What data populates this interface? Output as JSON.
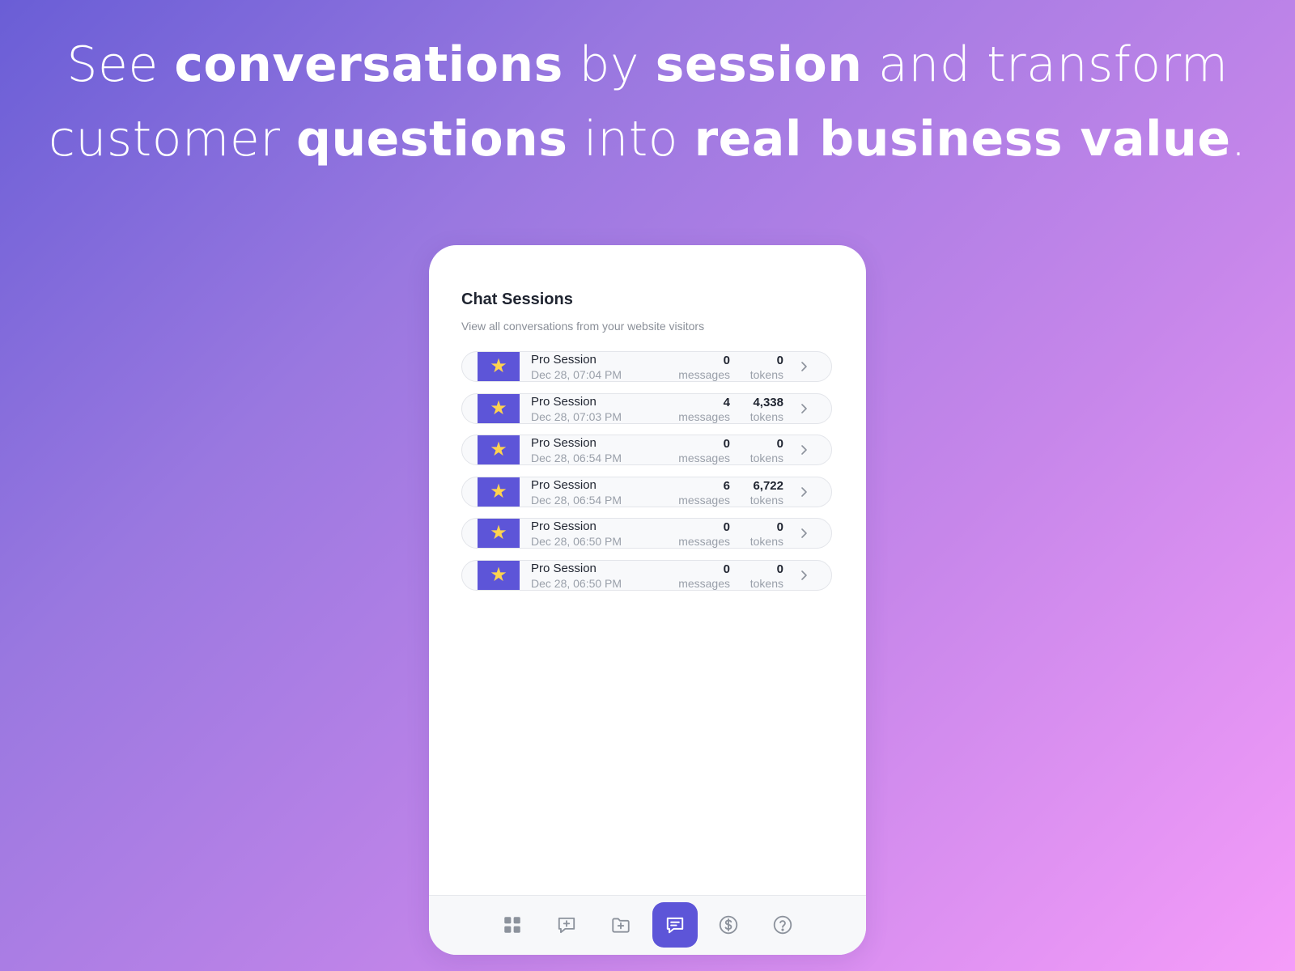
{
  "headline": {
    "line1": {
      "t1": "See ",
      "b1": "conversations",
      "t2": " by ",
      "b2": "session",
      "t3": " and transform"
    },
    "line2": {
      "t1": "customer ",
      "b1": "questions",
      "t2": " into ",
      "b2": "real business value",
      "t3": "."
    }
  },
  "card": {
    "title": "Chat Sessions",
    "subtitle": "View all conversations from your website visitors"
  },
  "sessions": [
    {
      "name": "Pro Session",
      "date": "Dec 28, 07:04 PM",
      "messages": "0",
      "messages_label": "messages",
      "tokens": "0",
      "tokens_label": "tokens",
      "badge_icon": "star-icon"
    },
    {
      "name": "Pro Session",
      "date": "Dec 28, 07:03 PM",
      "messages": "4",
      "messages_label": "messages",
      "tokens": "4,338",
      "tokens_label": "tokens",
      "badge_icon": "star-icon"
    },
    {
      "name": "Pro Session",
      "date": "Dec 28, 06:54 PM",
      "messages": "0",
      "messages_label": "messages",
      "tokens": "0",
      "tokens_label": "tokens",
      "badge_icon": "star-icon"
    },
    {
      "name": "Pro Session",
      "date": "Dec 28, 06:54 PM",
      "messages": "6",
      "messages_label": "messages",
      "tokens": "6,722",
      "tokens_label": "tokens",
      "badge_icon": "star-icon"
    },
    {
      "name": "Pro Session",
      "date": "Dec 28, 06:50 PM",
      "messages": "0",
      "messages_label": "messages",
      "tokens": "0",
      "tokens_label": "tokens",
      "badge_icon": "star-icon"
    },
    {
      "name": "Pro Session",
      "date": "Dec 28, 06:50 PM",
      "messages": "0",
      "messages_label": "messages",
      "tokens": "0",
      "tokens_label": "tokens",
      "badge_icon": "star-icon"
    }
  ],
  "tabbar": {
    "items": [
      {
        "icon": "grid-icon",
        "active": false
      },
      {
        "icon": "message-plus-icon",
        "active": false
      },
      {
        "icon": "folder-plus-icon",
        "active": false
      },
      {
        "icon": "chat-lines-icon",
        "active": true
      },
      {
        "icon": "dollar-circle-icon",
        "active": false
      },
      {
        "icon": "help-circle-icon",
        "active": false
      }
    ]
  },
  "colors": {
    "accent": "#5d55d8",
    "star": "#ffd34e",
    "gradient_start": "#6a5ed6",
    "gradient_end": "#f59cf9"
  }
}
